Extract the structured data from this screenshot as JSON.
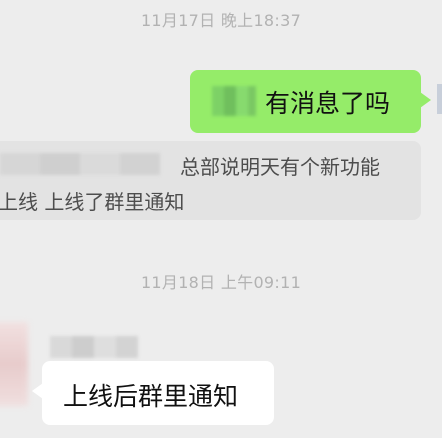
{
  "timestamps": {
    "first": "11月17日 晚上18:37",
    "second": "11月18日 上午09:11"
  },
  "messages": {
    "sent": {
      "text": "有消息了吗"
    },
    "quoted": {
      "line1": "总部说明天有个新功能",
      "line2": "上线 上线了群里通知"
    },
    "received": {
      "text": "上线后群里通知"
    }
  },
  "colors": {
    "background": "#ededed",
    "sent_bubble": "#95ec69",
    "received_bubble": "#ffffff",
    "quote_bubble": "#e3e3e3"
  }
}
